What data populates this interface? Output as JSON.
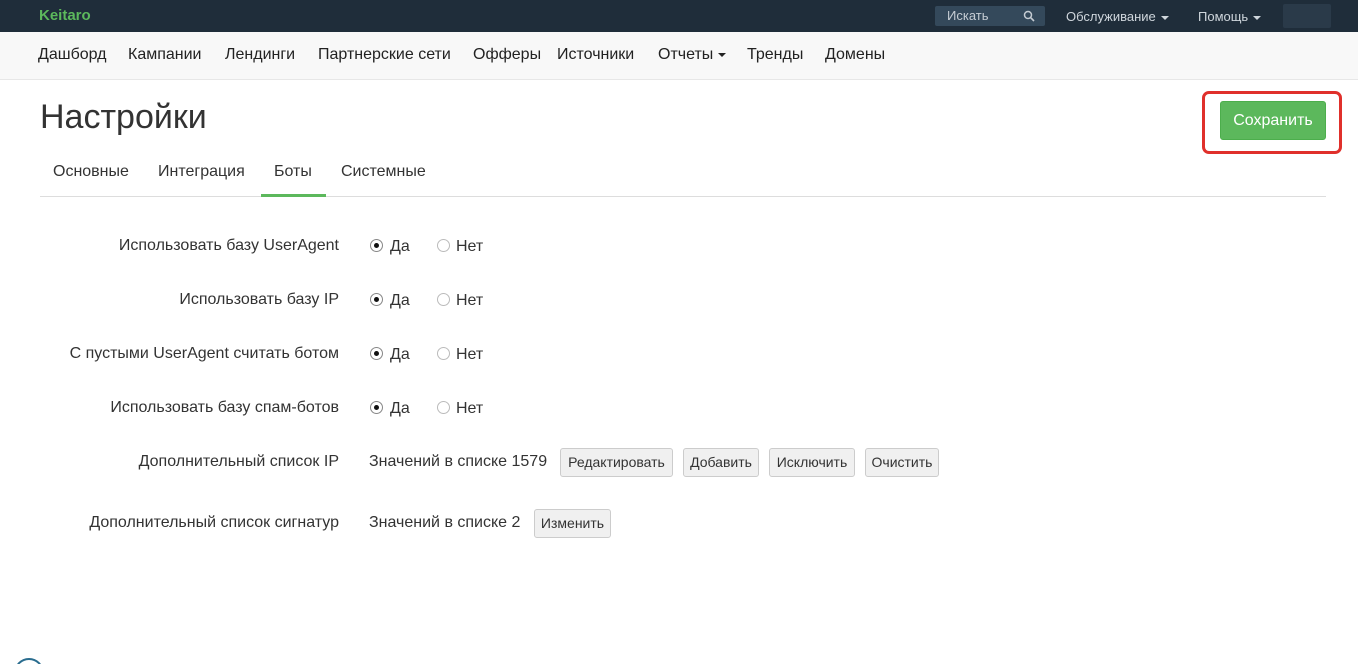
{
  "topbar": {
    "brand": "Keitaro",
    "search_placeholder": "Искать",
    "service_menu": "Обслуживание",
    "help_menu": "Помощь"
  },
  "nav": {
    "items": [
      "Дашборд",
      "Кампании",
      "Лендинги",
      "Партнерские сети",
      "Офферы",
      "Источники",
      "Отчеты",
      "Тренды",
      "Домены"
    ]
  },
  "page": {
    "title": "Настройки",
    "save_label": "Сохранить"
  },
  "tabs": {
    "items": [
      "Основные",
      "Интеграция",
      "Боты",
      "Системные"
    ],
    "active": "Боты"
  },
  "form": {
    "rows": [
      {
        "label": "Использовать базу UserAgent",
        "yes": "Да",
        "no": "Нет",
        "value": "Да"
      },
      {
        "label": "Использовать базу IP",
        "yes": "Да",
        "no": "Нет",
        "value": "Да"
      },
      {
        "label": "С пустыми UserAgent считать ботом",
        "yes": "Да",
        "no": "Нет",
        "value": "Да"
      },
      {
        "label": "Использовать базу спам-ботов",
        "yes": "Да",
        "no": "Нет",
        "value": "Да"
      }
    ],
    "ip_list": {
      "label": "Дополнительный список IP",
      "count_text": "Значений в списке 1579",
      "buttons": [
        "Редактировать",
        "Добавить",
        "Исключить",
        "Очистить"
      ]
    },
    "signature_list": {
      "label": "Дополнительный список сигнатур",
      "count_text": "Значений в списке 2",
      "buttons": [
        "Изменить"
      ]
    }
  },
  "colors": {
    "topbar": "#1f2d3a",
    "brand": "#5cb85c",
    "save_button": "#5cb85c",
    "highlight": "#e0302b"
  }
}
